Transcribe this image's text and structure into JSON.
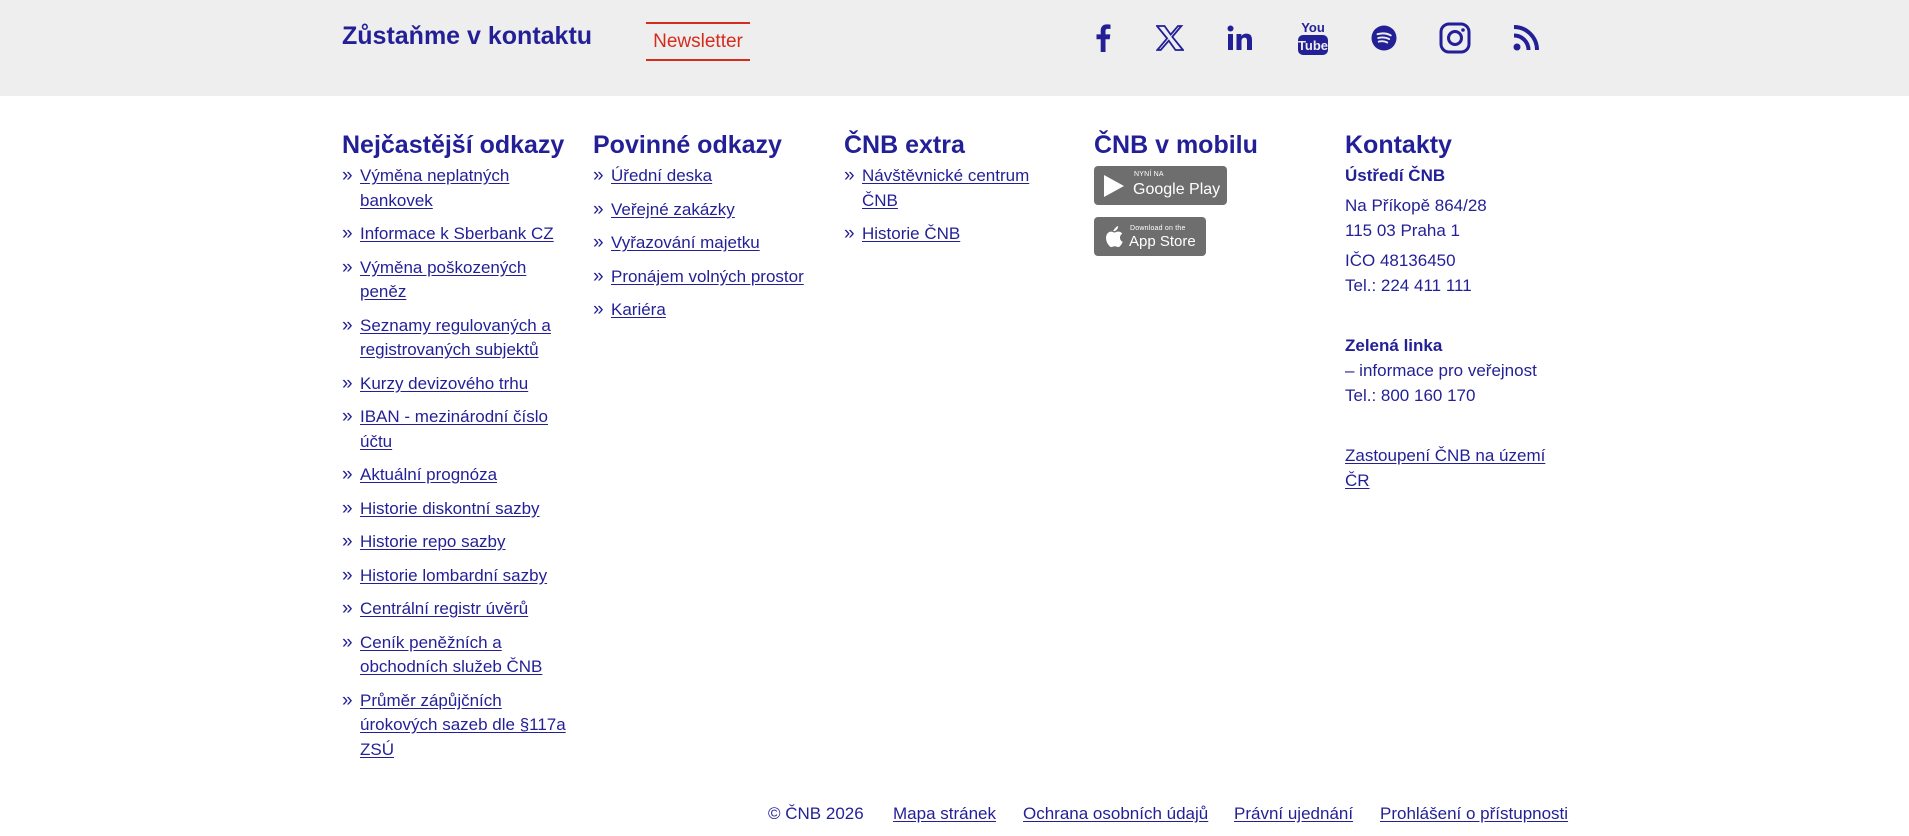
{
  "header": {
    "title": "Zůstaňme v kontaktu",
    "newsletter_label": "Newsletter",
    "social_icons": [
      "facebook-icon",
      "x-icon",
      "linkedin-icon",
      "youtube-icon",
      "spotify-icon",
      "instagram-icon",
      "rss-icon"
    ]
  },
  "columns": {
    "most_frequent": {
      "title": "Nejčastější odkazy",
      "links": [
        "Výměna neplatných bankovek",
        "Informace k Sberbank CZ",
        "Výměna poškozených peněz",
        "Seznamy regulovaných a registrovaných subjektů",
        "Kurzy devizového trhu",
        "IBAN - mezinárodní číslo účtu",
        "Aktuální prognóza",
        "Historie diskontní sazby",
        "Historie repo sazby",
        "Historie lombardní sazby",
        "Centrální registr úvěrů",
        "Ceník peněžních a obchodních služeb ČNB",
        "Průměr zápůjčních úrokových sazeb dle §117a ZSÚ"
      ]
    },
    "mandatory": {
      "title": "Povinné odkazy",
      "links": [
        "Úřední deska",
        "Veřejné zakázky",
        "Vyřazování majetku",
        "Pronájem volných prostor",
        "Kariéra"
      ]
    },
    "extra": {
      "title": "ČNB extra",
      "links": [
        "Návštěvnické centrum ČNB",
        "Historie ČNB"
      ]
    },
    "mobile": {
      "title": "ČNB v mobilu",
      "google_play_small": "NYNÍ NA",
      "google_play_big": "Google Play",
      "app_store_small": "Download on the",
      "app_store_big": "App Store"
    },
    "contacts": {
      "title": "Kontakty",
      "hq_name": "Ústředí ČNB",
      "address_line1": "Na Příkopě 864/28",
      "address_line2": "115 03 Praha 1",
      "ico": "IČO 48136450",
      "tel": "Tel.: 224 411 111",
      "green_line_title": "Zelená linka",
      "green_line_desc": "– informace pro veřejnost",
      "green_line_tel": "Tel.: 800 160 170",
      "regional_link": "Zastoupení ČNB na území ČR"
    }
  },
  "footer": {
    "copyright": "© ČNB 2026",
    "links": [
      "Mapa stránek",
      "Ochrana osobních údajů",
      "Právní ujednání",
      "Prohlášení o přístupnosti"
    ]
  }
}
